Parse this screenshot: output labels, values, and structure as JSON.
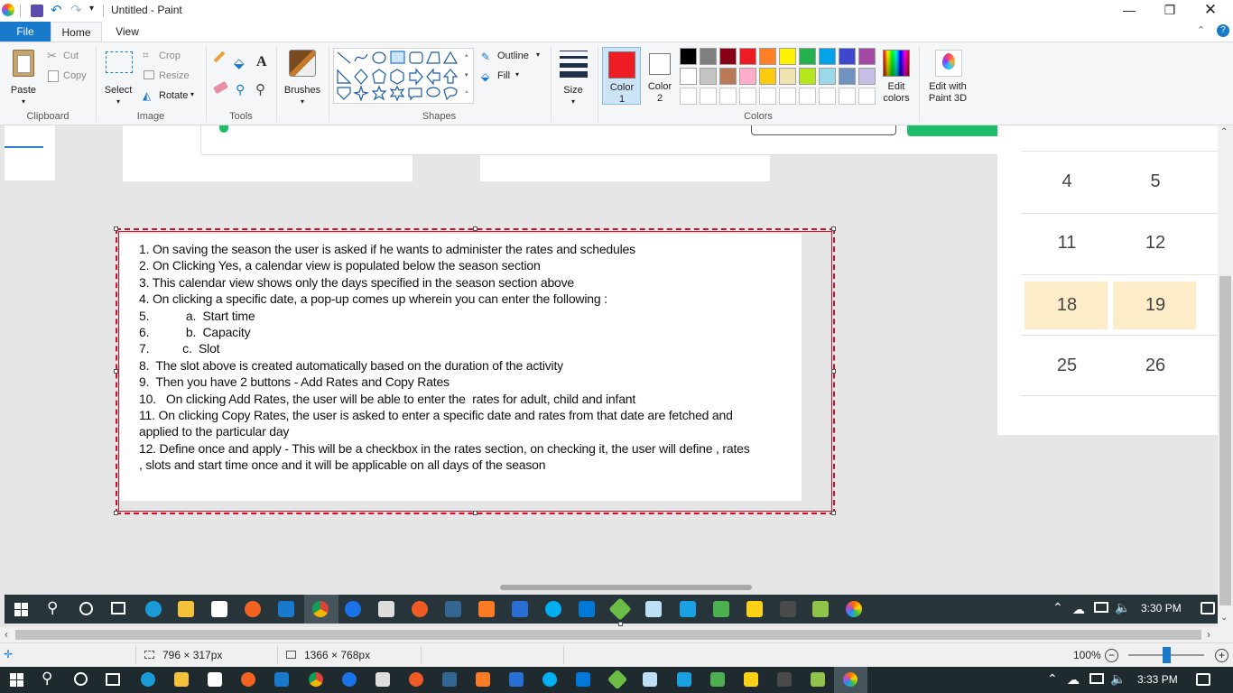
{
  "window": {
    "title": "Untitled - Paint"
  },
  "tabs": [
    {
      "label": "File"
    },
    {
      "label": "Home"
    },
    {
      "label": "View"
    }
  ],
  "ribbon": {
    "clipboard": {
      "group": "Clipboard",
      "paste": "Paste",
      "cut": "Cut",
      "copy": "Copy"
    },
    "image": {
      "group": "Image",
      "select": "Select",
      "crop": "Crop",
      "resize": "Resize",
      "rotate": "Rotate"
    },
    "tools": {
      "group": "Tools"
    },
    "brushes": {
      "label": "Brushes"
    },
    "shapes": {
      "group": "Shapes",
      "outline": "Outline",
      "fill": "Fill"
    },
    "size": {
      "label": "Size"
    },
    "colors": {
      "group": "Colors",
      "color1": "Color 1",
      "color2": "Color 2",
      "color1_value": "#ed1c24",
      "color2_value": "#ffffff",
      "edit_colors": "Edit colors",
      "paint3d": "Edit with Paint 3D",
      "palette_row1": [
        "#000000",
        "#7f7f7f",
        "#880015",
        "#ed1c24",
        "#ff7f27",
        "#fff200",
        "#22b14c",
        "#00a2e8",
        "#3f48cc",
        "#a349a4"
      ],
      "palette_row2": [
        "#ffffff",
        "#c3c3c3",
        "#b97a57",
        "#ffaec9",
        "#ffc90e",
        "#efe4b0",
        "#b5e61d",
        "#99d9ea",
        "#7092be",
        "#c8bfe7"
      ],
      "palette_row3": [
        "#ffffff",
        "#ffffff",
        "#ffffff",
        "#ffffff",
        "#ffffff",
        "#ffffff",
        "#ffffff",
        "#ffffff",
        "#ffffff",
        "#ffffff"
      ]
    }
  },
  "canvas": {
    "calendar_numbers": [
      "4",
      "5",
      "11",
      "12",
      "18",
      "19",
      "25",
      "26"
    ],
    "lines": [
      "1. On saving the season the user is asked if he wants to administer the rates and schedules",
      "2. On Clicking Yes, a calendar view is populated below the season section",
      "3. This calendar view shows only the days specified in the season section above",
      "4. On clicking a specific date, a pop-up comes up wherein you can enter the following :",
      "5.           a.  Start time",
      "6.           b.  Capacity",
      "7.          c.  Slot",
      "8.  The slot above is created automatically based on the duration of the activity",
      "9.  Then you have 2 buttons - Add Rates and Copy Rates",
      "10.   On clicking Add Rates, the user will be able to enter the  rates for adult, child and infant",
      "11. On clicking Copy Rates, the user is asked to enter a specific date and rates from that date are fetched and",
      "applied to the particular day",
      "12. Define once and apply - This will be a checkbox in the rates section, on checking it, the user will define , rates",
      ", slots and start time once and it will be applicable on all days of the season"
    ]
  },
  "inner_taskbar": {
    "clock": "3:30 PM"
  },
  "status": {
    "selection_size": "796 × 317px",
    "image_size": "1366 × 768px",
    "zoom": "100%"
  },
  "taskbar": {
    "clock": "3:33 PM"
  }
}
